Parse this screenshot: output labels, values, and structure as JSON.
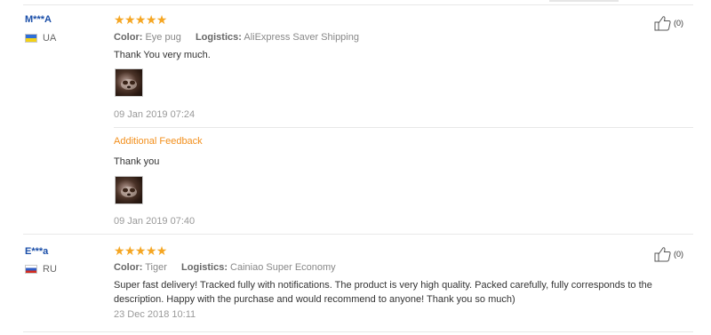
{
  "reviews": [
    {
      "user": "M***A",
      "country": "UA",
      "stars": "★★★★★",
      "color_label": "Color:",
      "color_value": "Eye pug",
      "logistics_label": "Logistics:",
      "logistics_value": "AliExpress Saver Shipping",
      "text": "Thank You very much.",
      "date": "09 Jan 2019 07:24",
      "helpful": "(0)",
      "additional_feedback": {
        "label": "Additional Feedback",
        "text": "Thank you",
        "date": "09 Jan 2019 07:40"
      }
    },
    {
      "user": "E***a",
      "country": "RU",
      "stars": "★★★★★",
      "color_label": "Color:",
      "color_value": "Tiger",
      "logistics_label": "Logistics:",
      "logistics_value": "Cainiao Super Economy",
      "text": "Super fast delivery! Tracked fully with notifications. The product is very high quality. Packed carefully, fully corresponds to the description. Happy with the purchase and would recommend to anyone! Thank you so much)",
      "date": "23 Dec 2018 10:11",
      "helpful": "(0)"
    }
  ],
  "colors": {
    "star": "#f5a623",
    "username": "#1a4ea8",
    "feedback_label": "#f28f1c"
  }
}
